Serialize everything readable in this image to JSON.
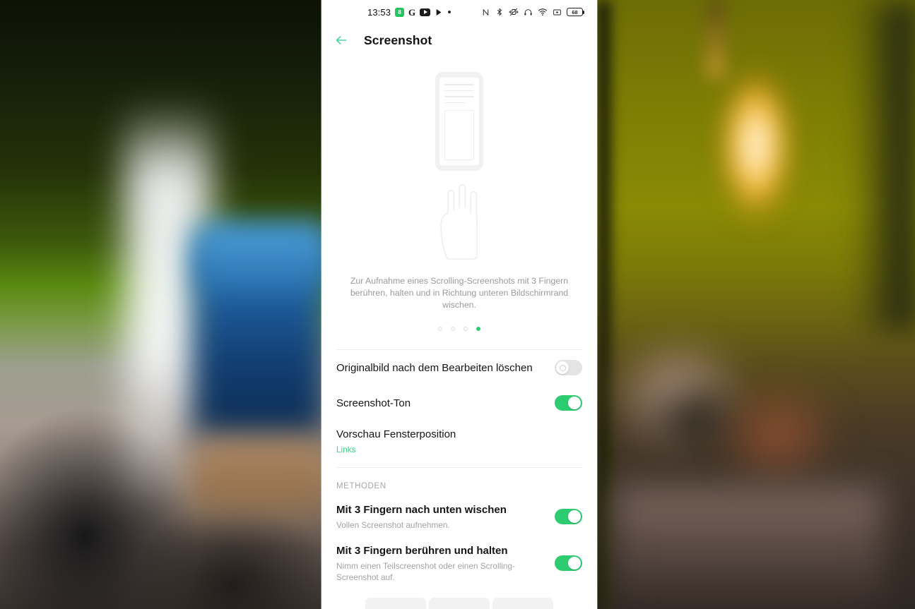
{
  "statusbar": {
    "time": "13:53",
    "notification_icons": [
      "green-app-icon",
      "google-g-icon",
      "youtube-icon",
      "play-store-icon",
      "more-dot-icon"
    ],
    "system_icons": [
      "nfc-icon",
      "bluetooth-icon",
      "vibrate-icon",
      "headphone-icon",
      "wifi-icon",
      "screenshot-icon"
    ],
    "battery_level": "68"
  },
  "toolbar": {
    "title": "Screenshot",
    "back_label": "back-arrow"
  },
  "hero": {
    "description": "Zur Aufnahme eines Scrolling-Screenshots mit 3 Fingern berühren, halten und in Richtung unteren Bildschirmrand wischen.",
    "dots_total": 4,
    "dots_active_index": 3
  },
  "settings": {
    "rows": [
      {
        "title": "Originalbild nach dem Bearbeiten löschen",
        "sub": null,
        "toggle": "off"
      },
      {
        "title": "Screenshot-Ton",
        "sub": null,
        "toggle": "on"
      },
      {
        "title": "Vorschau Fensterposition",
        "sub": "Links",
        "toggle": null
      }
    ],
    "section_methods_label": "METHODEN",
    "methods": [
      {
        "title": "Mit 3 Fingern nach unten wischen",
        "sub": "Vollen Screenshot aufnehmen.",
        "toggle": "on"
      },
      {
        "title": "Mit 3 Fingern berühren und halten",
        "sub": "Nimm einen Teilscreenshot oder einen Scrolling-Screenshot auf.",
        "toggle": "on"
      }
    ]
  },
  "colors": {
    "accent_green": "#2ecc71",
    "accent_link": "#3fd186",
    "text_primary": "#151515",
    "text_secondary": "#a3a3a3"
  }
}
